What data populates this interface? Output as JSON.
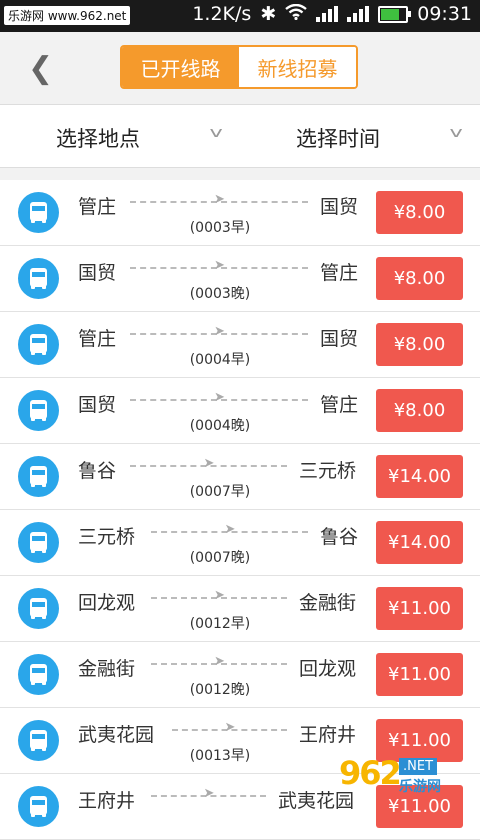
{
  "status_bar": {
    "site_label": "乐游网 www.962.net",
    "net_speed": "1.2K/s",
    "time": "09:31"
  },
  "header": {
    "tabs": [
      {
        "label": "已开线路",
        "active": true
      },
      {
        "label": "新线招募",
        "active": false
      }
    ]
  },
  "filters": {
    "location_label": "选择地点",
    "time_label": "选择时间"
  },
  "routes": [
    {
      "from": "管庄",
      "to": "国贸",
      "code": "(0003早)",
      "price": "¥8.00"
    },
    {
      "from": "国贸",
      "to": "管庄",
      "code": "(0003晚)",
      "price": "¥8.00"
    },
    {
      "from": "管庄",
      "to": "国贸",
      "code": "(0004早)",
      "price": "¥8.00"
    },
    {
      "from": "国贸",
      "to": "管庄",
      "code": "(0004晚)",
      "price": "¥8.00"
    },
    {
      "from": "鲁谷",
      "to": "三元桥",
      "code": "(0007早)",
      "price": "¥14.00"
    },
    {
      "from": "三元桥",
      "to": "鲁谷",
      "code": "(0007晚)",
      "price": "¥14.00"
    },
    {
      "from": "回龙观",
      "to": "金融街",
      "code": "(0012早)",
      "price": "¥11.00"
    },
    {
      "from": "金融街",
      "to": "回龙观",
      "code": "(0012晚)",
      "price": "¥11.00"
    },
    {
      "from": "武夷花园",
      "to": "王府井",
      "code": "(0013早)",
      "price": "¥11.00"
    },
    {
      "from": "王府井",
      "to": "武夷花园",
      "code": "",
      "price": "¥11.00"
    }
  ],
  "watermark": {
    "brand_number": "962",
    "site": ".NET",
    "name": "乐游网"
  },
  "colors": {
    "accent_orange": "#f59a2c",
    "price_red": "#f0584e",
    "bus_blue": "#2aa6ea"
  }
}
